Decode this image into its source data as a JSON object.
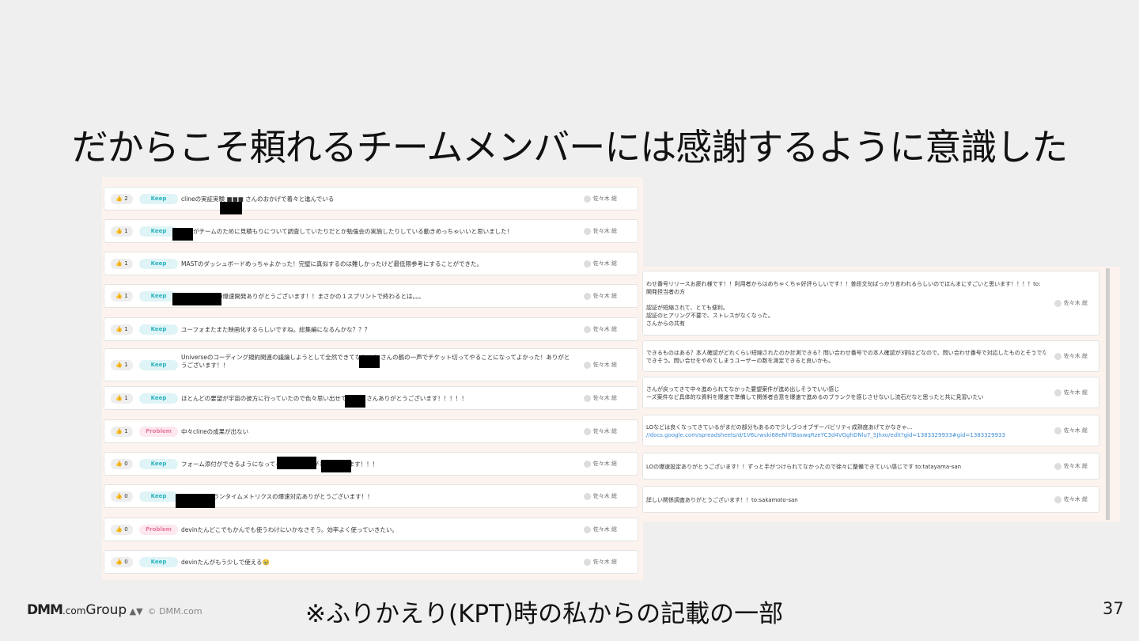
{
  "slide": {
    "title": "だからこそ頼れるチームメンバーには感謝するように意識した",
    "caption": "※ふりかえり(KPT)時の私からの記載の一部",
    "page_number": "37",
    "logo_main": "DMM",
    "logo_com": ".com",
    "logo_group": "Group",
    "logo_copyright": "© DMM.com"
  },
  "list1": [
    {
      "likes": "👍 2",
      "tag": "Keep",
      "text": "clineの実証実験 ■■■ さんのおかげで着々と進んでいる",
      "user": "佐々木 総"
    },
    {
      "likes": "👍 1",
      "tag": "Keep",
      "text": "さんがチームのために見積もりについて調査していたりだとか勉強会の実施したりしている動きめっちゃいいと思いました！",
      "user": "佐々木 総"
    },
    {
      "likes": "👍 1",
      "tag": "Keep",
      "text": "MASTのダッシュボードめっちゃよかった！完璧に真似するのは難しかったけど最低限参考にすることができた。",
      "user": "佐々木 総"
    },
    {
      "likes": "👍 1",
      "tag": "Keep",
      "text": "さん区分関連の爆速開発ありがとうございます！！まさかの１スプリントで終わるとは。。。",
      "user": "佐々木 総"
    },
    {
      "likes": "👍 1",
      "tag": "Keep",
      "text": "ユーフォまたまた映画化するらしいですね。総集編になるんかな？？？",
      "user": "佐々木 総"
    },
    {
      "likes": "👍 1",
      "tag": "Keep",
      "text": "Universeのコーディング規約関連の議論しようとして全然できてなかった さんの鶴の一声でチケット切ってやることになってよかった！ありがとうございます！！",
      "user": "佐々木 総"
    },
    {
      "likes": "👍 1",
      "tag": "Keep",
      "text": "ほとんどの要望が宇宙の彼方に行っていたので色々思い出せてよかっ さんありがとうございます！！！！！",
      "user": "佐々木 総"
    },
    {
      "likes": "👍 1",
      "tag": "Problem",
      "text": "中々clineの成果が出ない",
      "user": "佐々木 総"
    },
    {
      "likes": "👍 0",
      "tag": "Keep",
      "text": "フォーム添付ができるようになってる！ さんありがとうございます！！！",
      "user": "佐々木 総"
    },
    {
      "likes": "👍 0",
      "tag": "Keep",
      "text": "DataDogのランタイムメトリクスの爆速対応ありがとうございます！！",
      "user": "佐々木 総"
    },
    {
      "likes": "👍 0",
      "tag": "Problem",
      "text": "devinたんどこでもかんでも使うわけにいかなさそう。効率よく使っていきたい。",
      "user": "佐々木 総"
    },
    {
      "likes": "👍 0",
      "tag": "Keep",
      "text": "devinたんがもう少しで使える🥹",
      "user": "佐々木 総"
    }
  ],
  "list2": [
    {
      "lines": [
        "わせ番号リリースお疲れ様です！！利用者からはめちゃくちゃ好評らしいです！！普段文句ばっかり言われるらしいのでほんまにすごいと思います！！！！to:",
        "開発担当者の方",
        "",
        "認証が短縮されて、とても便利。",
        "認証のヒアリング不要で、ストレスがなくなった。",
        "さんからの共有"
      ],
      "user": "佐々木 総"
    },
    {
      "lines": [
        "できるものはある？本人確認がどれくらい短縮されたのか計測できる？問い合わせ番号での本人確認が3割ほどなので、問い合わせ番号で対応したものとそうでないものの通話時間を比",
        "できそう。問い合せをやめてしまうユーザーの数を測定できると良いかも。"
      ],
      "user": "佐々木 総"
    },
    {
      "lines": [
        "さんが戻ってきて中々進められてなかった要望案件が進め出しそうでいい感じ",
        "ーズ案件など具体的な資料を爆速で準備して関係者合意を爆速で進めるのブランクを感じさせないし流石だなと思ったと共に見習いたい"
      ],
      "user": "佐々木 総"
    },
    {
      "lines": [
        "LOなどは良くなってきているがまだの部分もあるので少しづつオブザーバビリティ成熟度あげてかなきゃ...",
        "//docs.google.com/spreadsheets/d/1V6Lrwski68eNlYlBaswqRzeYC3d4VGghDNlu7_SJhxo/edit?gid=1383329933#gid=1383329933"
      ],
      "user": "佐々木 総"
    },
    {
      "lines": [
        "LOの爆速設定ありがとうございます！！ずっと手がつけられてなかったので徐々に整備できていい感じです to:tatayama-san"
      ],
      "user": "佐々木 総"
    },
    {
      "lines": [
        "詳しい関係調査ありがとうございます！！to:sakamoto-san"
      ],
      "user": "佐々木 総"
    }
  ]
}
